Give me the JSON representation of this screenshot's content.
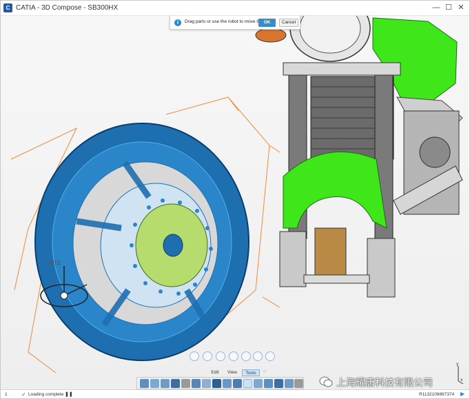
{
  "window": {
    "app_icon": "C",
    "title": "CATIA - 3D Compose - SB300HX",
    "minimize_label": "—",
    "maximize_label": "☐",
    "close_label": "✕"
  },
  "hint": {
    "icon": "i",
    "text": "Drag parts or use the robot to move them.",
    "ok_label": "OK",
    "cancel_label": "Cancel"
  },
  "robot": {
    "axis_label": "w|z"
  },
  "tabs": [
    {
      "label": "Edit"
    },
    {
      "label": "View"
    },
    {
      "label": "Tools",
      "selected": true
    },
    {
      "label": "♡"
    }
  ],
  "toolbar": {
    "tools": [
      "move-tool",
      "scale-tool",
      "align-tool",
      "explode-tool",
      "filter-tool",
      "section-tool",
      "snapshot-tool",
      "bom-tool",
      "render-tool",
      "measure-tool",
      "zoom-tool",
      "camera-tool",
      "annotation-tool",
      "publish-tool",
      "export-tool",
      "settings-tool"
    ]
  },
  "floating_tools": [
    "add-icon",
    "select-icon",
    "transform-icon",
    "annotate-icon",
    "link-icon",
    "mirror-icon",
    "settings-icon"
  ],
  "compass": {
    "x_label": "x",
    "y_label": "y"
  },
  "watermark": {
    "text": "上海耀唐科技有限公司"
  },
  "status": {
    "page": "1",
    "check_icon": "✓",
    "message": "Loading complete",
    "pause_icon": "❚❚",
    "id": "R1132106867374",
    "play_icon": "▶"
  },
  "colors": {
    "accent": "#368ec4",
    "highlight_blue": "#1e88d8",
    "green_parts": "#3ee61a",
    "orange_frame": "#f08a3c"
  }
}
